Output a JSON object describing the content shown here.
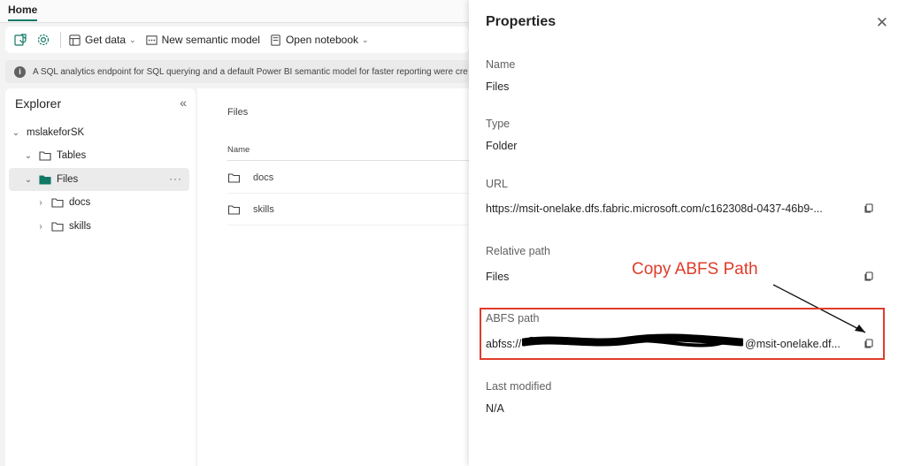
{
  "tabs": {
    "home_label": "Home"
  },
  "toolbar": {
    "get_data": "Get data",
    "new_semantic_model": "New semantic model",
    "open_notebook": "Open notebook"
  },
  "banner": {
    "text": "A SQL analytics endpoint for SQL querying and a default Power BI semantic model for faster reporting were cre"
  },
  "explorer": {
    "title": "Explorer",
    "lakehouse": "mslakeforSK",
    "tables": "Tables",
    "files": "Files",
    "subfolders": [
      "docs",
      "skills"
    ]
  },
  "main": {
    "title": "Files",
    "column_name": "Name",
    "rows": [
      "docs",
      "skills"
    ]
  },
  "properties": {
    "title": "Properties",
    "name_label": "Name",
    "name_value": "Files",
    "type_label": "Type",
    "type_value": "Folder",
    "url_label": "URL",
    "url_value": "https://msit-onelake.dfs.fabric.microsoft.com/c162308d-0437-46b9-...",
    "relative_path_label": "Relative path",
    "relative_path_value": "Files",
    "abfs_label": "ABFS path",
    "abfs_prefix": "abfss://",
    "abfs_suffix": "@msit-onelake.df...",
    "last_modified_label": "Last modified",
    "last_modified_value": "N/A"
  },
  "annotation": {
    "text": "Copy ABFS Path",
    "color": "#e03c2a"
  },
  "colors": {
    "accent": "#117865",
    "annotation": "#e03c2a"
  }
}
